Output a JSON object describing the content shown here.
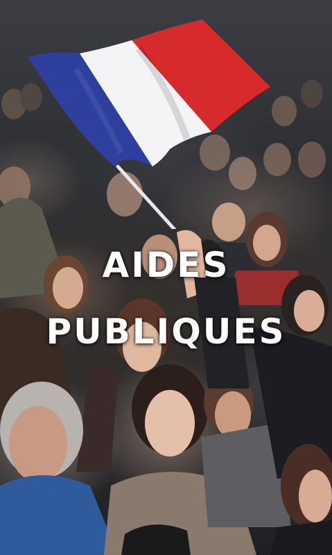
{
  "headline": {
    "line1": "AIDES",
    "line2": "PUBLIQUES"
  },
  "flag": {
    "colors": {
      "blue": "#2f3f9e",
      "white": "#f4f4f6",
      "red": "#d62a2c"
    }
  }
}
